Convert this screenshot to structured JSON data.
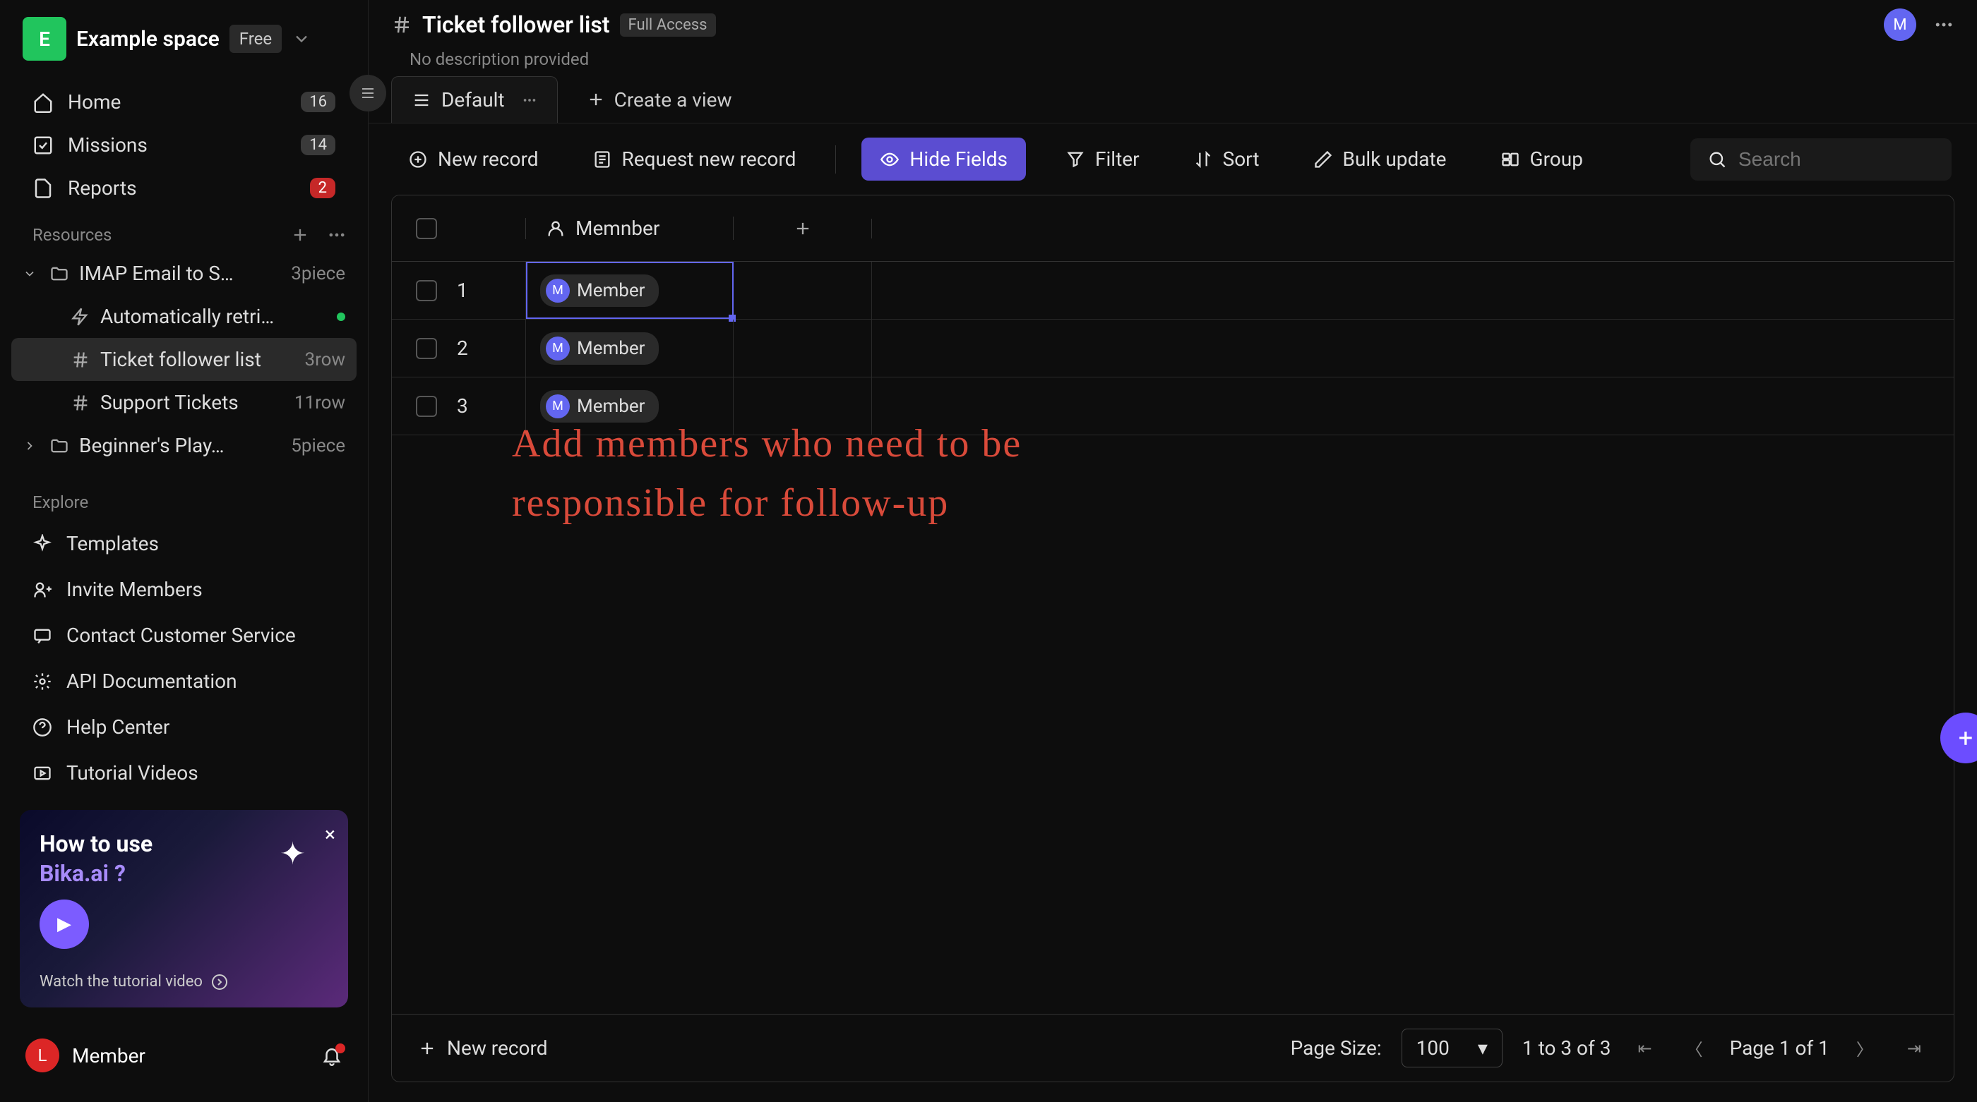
{
  "workspace": {
    "initial": "E",
    "name": "Example space",
    "plan": "Free"
  },
  "nav": {
    "home": {
      "label": "Home",
      "count": "16"
    },
    "missions": {
      "label": "Missions",
      "count": "14"
    },
    "reports": {
      "label": "Reports",
      "count": "2"
    }
  },
  "resources": {
    "title": "Resources",
    "imap": {
      "label": "IMAP Email to S…",
      "meta": "3piece"
    },
    "auto": {
      "label": "Automatically retriev…"
    },
    "followers": {
      "label": "Ticket follower list",
      "meta": "3row"
    },
    "support": {
      "label": "Support Tickets",
      "meta": "11row"
    },
    "beginner": {
      "label": "Beginner's Play…",
      "meta": "5piece"
    }
  },
  "explore": {
    "title": "Explore",
    "templates": "Templates",
    "invite": "Invite Members",
    "contact": "Contact Customer Service",
    "api": "API Documentation",
    "help": "Help Center",
    "tutorial": "Tutorial Videos"
  },
  "promo": {
    "line1": "How to use",
    "line2": "Bika.ai ?",
    "footer": "Watch the tutorial video"
  },
  "user": {
    "initial": "L",
    "name": "Member"
  },
  "header": {
    "title": "Ticket follower list",
    "access": "Full Access",
    "subtitle": "No description provided",
    "avatar": "M"
  },
  "views": {
    "default": "Default",
    "create": "Create a view"
  },
  "toolbar": {
    "new_record": "New record",
    "request": "Request new record",
    "hide": "Hide Fields",
    "filter": "Filter",
    "sort": "Sort",
    "bulk": "Bulk update",
    "group": "Group",
    "search_placeholder": "Search"
  },
  "table": {
    "column": "Memnber",
    "rows": [
      {
        "num": "1",
        "avatar": "M",
        "name": "Member"
      },
      {
        "num": "2",
        "avatar": "M",
        "name": "Member"
      },
      {
        "num": "3",
        "avatar": "M",
        "name": "Member"
      }
    ]
  },
  "callout": {
    "line1": "Add members who need to be",
    "line2": "responsible for follow-up"
  },
  "footer": {
    "new_record": "New record",
    "page_size_label": "Page Size:",
    "page_size_value": "100",
    "range": "1 to 3 of 3",
    "page": "Page 1 of 1"
  }
}
